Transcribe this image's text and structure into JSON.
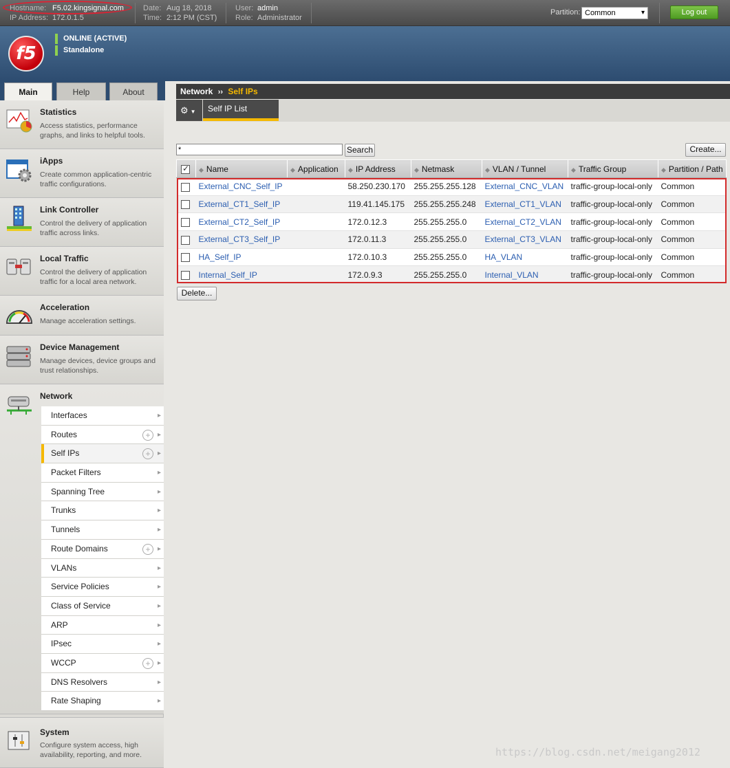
{
  "topbar": {
    "hostname_label": "Hostname:",
    "hostname": "F5.02.kingsignal.com",
    "ip_label": "IP Address:",
    "ip": "172.0.1.5",
    "date_label": "Date:",
    "date": "Aug 18, 2018",
    "time_label": "Time:",
    "time": "2:12 PM (CST)",
    "user_label": "User:",
    "user": "admin",
    "role_label": "Role:",
    "role": "Administrator",
    "partition_label": "Partition:",
    "partition_value": "Common",
    "logout_label": "Log out"
  },
  "banner": {
    "logo_text": "f5",
    "status_online": "ONLINE (ACTIVE)",
    "status_mode": "Standalone"
  },
  "tabs": [
    "Main",
    "Help",
    "About"
  ],
  "nav": [
    {
      "title": "Statistics",
      "desc": "Access statistics, performance graphs, and links to helpful tools.",
      "icon": "statistics-chart-icon"
    },
    {
      "title": "iApps",
      "desc": "Create common application-centric traffic configurations.",
      "icon": "iapps-window-gear-icon"
    },
    {
      "title": "Link Controller",
      "desc": "Control the delivery of application traffic across links.",
      "icon": "link-controller-building-icon"
    },
    {
      "title": "Local Traffic",
      "desc": "Control the delivery of application traffic for a local area network.",
      "icon": "local-traffic-servers-icon"
    },
    {
      "title": "Acceleration",
      "desc": "Manage acceleration settings.",
      "icon": "speedometer-icon"
    },
    {
      "title": "Device Management",
      "desc": "Manage devices, device groups and trust relationships.",
      "icon": "device-stack-icon"
    },
    {
      "title": "Network",
      "desc": "",
      "icon": "network-device-icon"
    },
    {
      "title": "System",
      "desc": "Configure system access, high availability, reporting, and more.",
      "icon": "system-panel-icon"
    }
  ],
  "network_sub": [
    {
      "label": "Interfaces",
      "kind": "chevron"
    },
    {
      "label": "Routes",
      "kind": "plus"
    },
    {
      "label": "Self IPs",
      "kind": "plus",
      "selected": true
    },
    {
      "label": "Packet Filters",
      "kind": "chevron"
    },
    {
      "label": "Spanning Tree",
      "kind": "chevron"
    },
    {
      "label": "Trunks",
      "kind": "chevron"
    },
    {
      "label": "Tunnels",
      "kind": "chevron"
    },
    {
      "label": "Route Domains",
      "kind": "plus"
    },
    {
      "label": "VLANs",
      "kind": "chevron"
    },
    {
      "label": "Service Policies",
      "kind": "chevron"
    },
    {
      "label": "Class of Service",
      "kind": "chevron"
    },
    {
      "label": "ARP",
      "kind": "chevron"
    },
    {
      "label": "IPsec",
      "kind": "chevron"
    },
    {
      "label": "WCCP",
      "kind": "plus"
    },
    {
      "label": "DNS Resolvers",
      "kind": "chevron"
    },
    {
      "label": "Rate Shaping",
      "kind": "chevron"
    }
  ],
  "breadcrumb": {
    "parent": "Network",
    "separator": "››",
    "current": "Self IPs"
  },
  "toolbar": {
    "subtab": "Self IP List"
  },
  "search": {
    "value": "*",
    "button": "Search",
    "create": "Create..."
  },
  "table": {
    "columns": [
      "Name",
      "Application",
      "IP Address",
      "Netmask",
      "VLAN / Tunnel",
      "Traffic Group",
      "Partition / Path"
    ],
    "rows": [
      {
        "name": "External_CNC_Self_IP",
        "application": "",
        "ip": "58.250.230.170",
        "netmask": "255.255.255.128",
        "vlan": "External_CNC_VLAN",
        "traffic_group": "traffic-group-local-only",
        "partition": "Common"
      },
      {
        "name": "External_CT1_Self_IP",
        "application": "",
        "ip": "119.41.145.175",
        "netmask": "255.255.255.248",
        "vlan": "External_CT1_VLAN",
        "traffic_group": "traffic-group-local-only",
        "partition": "Common"
      },
      {
        "name": "External_CT2_Self_IP",
        "application": "",
        "ip": "172.0.12.3",
        "netmask": "255.255.255.0",
        "vlan": "External_CT2_VLAN",
        "traffic_group": "traffic-group-local-only",
        "partition": "Common"
      },
      {
        "name": "External_CT3_Self_IP",
        "application": "",
        "ip": "172.0.11.3",
        "netmask": "255.255.255.0",
        "vlan": "External_CT3_VLAN",
        "traffic_group": "traffic-group-local-only",
        "partition": "Common"
      },
      {
        "name": "HA_Self_IP",
        "application": "",
        "ip": "172.0.10.3",
        "netmask": "255.255.255.0",
        "vlan": "HA_VLAN",
        "traffic_group": "traffic-group-local-only",
        "partition": "Common"
      },
      {
        "name": "Internal_Self_IP",
        "application": "",
        "ip": "172.0.9.3",
        "netmask": "255.255.255.0",
        "vlan": "Internal_VLAN",
        "traffic_group": "traffic-group-local-only",
        "partition": "Common"
      }
    ],
    "delete_label": "Delete..."
  },
  "watermark": "https://blog.csdn.net/meigang2012",
  "colors": {
    "accent": "#f5b800",
    "link": "#2a5db0",
    "highlight_box": "#d32a2a",
    "online": "#8fd14f"
  }
}
